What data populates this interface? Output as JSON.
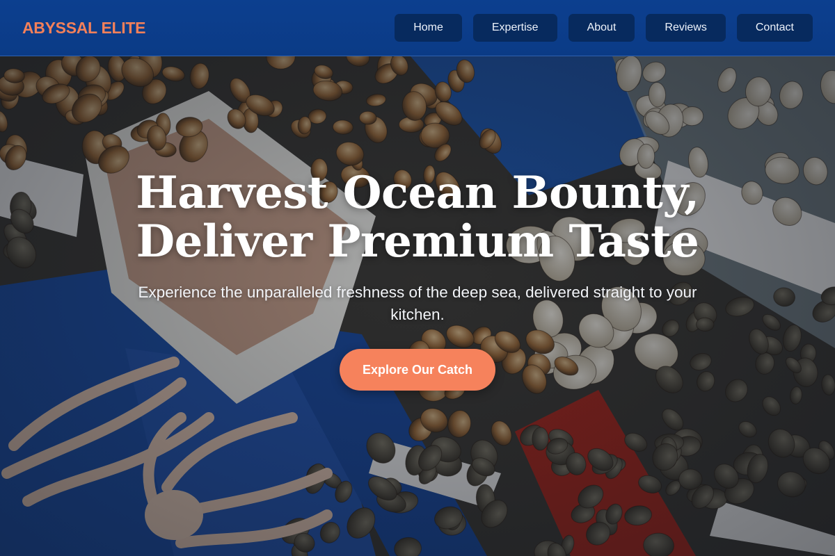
{
  "header": {
    "logo": "ABYSSAL ELITE",
    "nav": [
      {
        "label": "Home"
      },
      {
        "label": "Expertise"
      },
      {
        "label": "About"
      },
      {
        "label": "Reviews"
      },
      {
        "label": "Contact"
      }
    ]
  },
  "hero": {
    "title_line1": "Harvest Ocean Bounty,",
    "title_line2": "Deliver Premium Taste",
    "subtitle": "Experience the unparalleled freshness of the deep sea, delivered straight to your kitchen.",
    "cta_label": "Explore Our Catch",
    "background": "seafood-market-photo"
  },
  "colors": {
    "header_bg": "#0b3b86",
    "nav_button_bg": "#072a5e",
    "accent": "#f6825c",
    "logo": "#f2805a"
  }
}
